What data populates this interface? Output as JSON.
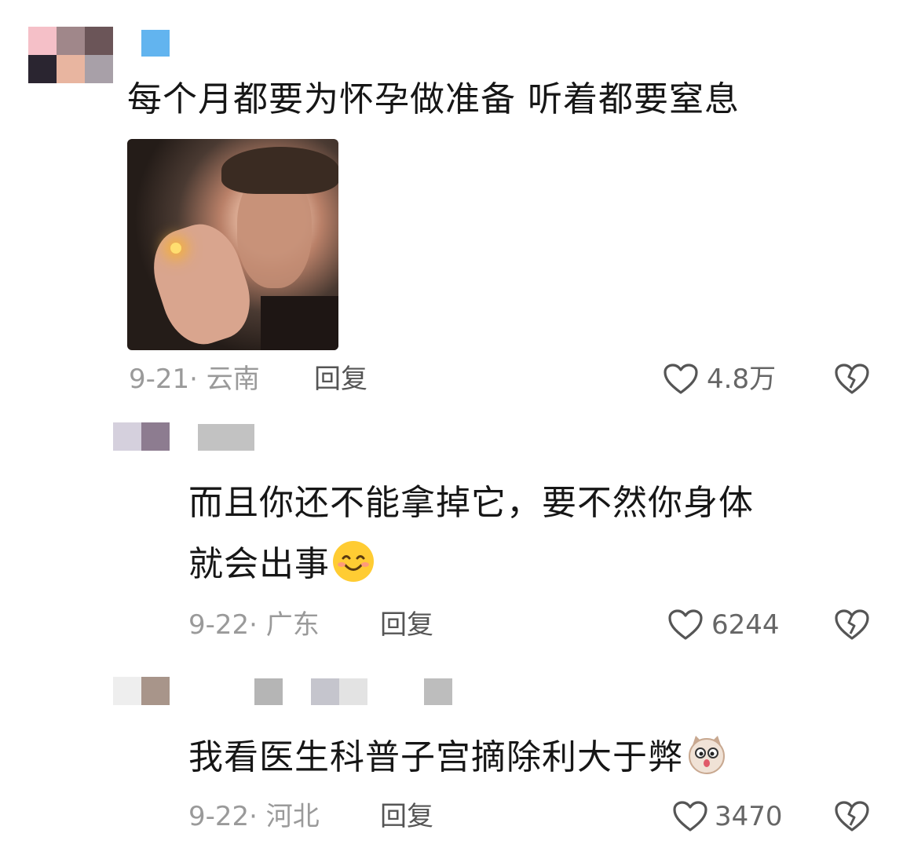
{
  "comments": [
    {
      "text": "每个月都要为怀孕做准备 听着都要窒息",
      "date_location": "9-21· 云南",
      "reply_label": "回复",
      "likes": "4.8万",
      "has_image": true
    },
    {
      "text_line1": "而且你还不能拿掉它，要不然你身体",
      "text_line2": "就会出事",
      "date_location": "9-22· 广东",
      "reply_label": "回复",
      "likes": "6244",
      "emoji": "smiling-face"
    },
    {
      "text": "我看医生科普子宫摘除利大于弊",
      "date_location": "9-22· 河北",
      "reply_label": "回复",
      "likes": "3470",
      "emoji": "cat-face"
    }
  ],
  "icons": {
    "like": "heart-outline-icon",
    "dislike": "broken-heart-icon"
  },
  "colors": {
    "text": "#161616",
    "meta": "#9a9a9a",
    "icon": "#555555"
  }
}
